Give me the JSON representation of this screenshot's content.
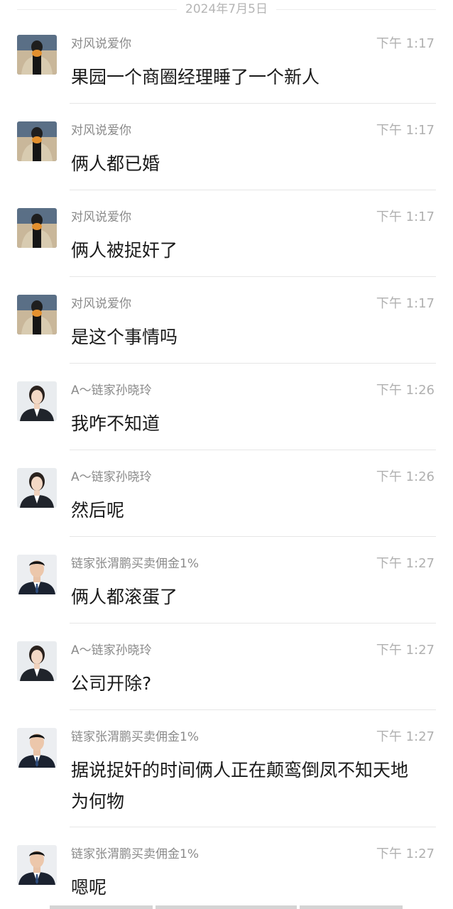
{
  "date_header": "2024年7月5日",
  "messages": [
    {
      "sender": "对风说爱你",
      "time": "下午 1:17",
      "text": "果园一个商圈经理睡了一个新人",
      "avatar": "avatar-duifeng"
    },
    {
      "sender": "对风说爱你",
      "time": "下午 1:17",
      "text": "俩人都已婚",
      "avatar": "avatar-duifeng"
    },
    {
      "sender": "对风说爱你",
      "time": "下午 1:17",
      "text": "俩人被捉奸了",
      "avatar": "avatar-duifeng"
    },
    {
      "sender": "对风说爱你",
      "time": "下午 1:17",
      "text": "是这个事情吗",
      "avatar": "avatar-duifeng"
    },
    {
      "sender": "A～链家孙晓玲",
      "time": "下午 1:26",
      "text": "我咋不知道",
      "avatar": "avatar-sun"
    },
    {
      "sender": "A～链家孙晓玲",
      "time": "下午 1:26",
      "text": "然后呢",
      "avatar": "avatar-sun"
    },
    {
      "sender": "链家张渭鹏买卖佣金1%",
      "time": "下午 1:27",
      "text": "俩人都滚蛋了",
      "avatar": "avatar-zhang"
    },
    {
      "sender": "A～链家孙晓玲",
      "time": "下午 1:27",
      "text": "公司开除?",
      "avatar": "avatar-sun"
    },
    {
      "sender": "链家张渭鹏买卖佣金1%",
      "time": "下午 1:27",
      "text": "据说捉奸的时间俩人正在颠鸾倒凤不知天地为何物",
      "avatar": "avatar-zhang"
    },
    {
      "sender": "链家张渭鹏买卖佣金1%",
      "time": "下午 1:27",
      "text": "嗯呢",
      "avatar": "avatar-zhang"
    }
  ]
}
